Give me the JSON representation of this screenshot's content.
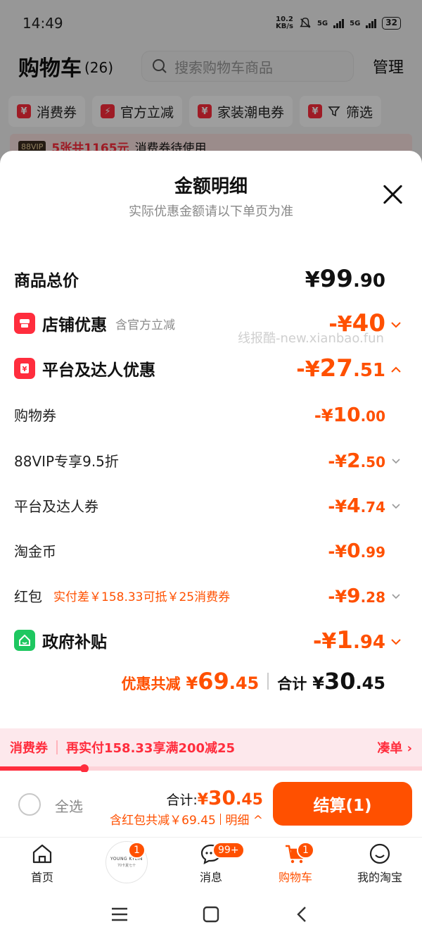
{
  "status": {
    "time": "14:49",
    "net_speed": "10.2",
    "net_unit": "KB/s",
    "sig1": "5G",
    "sig2": "5G",
    "battery": "32"
  },
  "header": {
    "title": "购物车",
    "count": "(26)",
    "search_placeholder": "搜索购物车商品",
    "manage": "管理"
  },
  "chips": [
    "消费券",
    "官方立减",
    "家装潮电券",
    "筛选"
  ],
  "vip_bar": {
    "tag": "88VIP",
    "amount": "5张共1165元",
    "text": "消费券待使用"
  },
  "sheet": {
    "title": "金额明细",
    "subtitle": "实际优惠金额请以下单页为准",
    "watermark": "线报酷-new.xianbao.fun",
    "total_price": {
      "label": "商品总价",
      "yen": "¥",
      "int": "99",
      "dec": ".90"
    },
    "shop_discount": {
      "label": "店铺优惠",
      "note": "含官方立减",
      "yen": "-¥",
      "int": "40",
      "dec": ""
    },
    "platform_discount": {
      "label": "平台及达人优惠",
      "yen": "-¥",
      "int": "27",
      "dec": ".51"
    },
    "items": [
      {
        "label": "购物券",
        "note": "",
        "yen": "-¥",
        "int": "10",
        "dec": ".00"
      },
      {
        "label": "88VIP专享9.5折",
        "note": "",
        "yen": "-¥",
        "int": "2",
        "dec": ".50"
      },
      {
        "label": "平台及达人券",
        "note": "",
        "yen": "-¥",
        "int": "4",
        "dec": ".74"
      },
      {
        "label": "淘金币",
        "note": "",
        "yen": "-¥",
        "int": "0",
        "dec": ".99"
      },
      {
        "label": "红包",
        "note": "实付差￥158.33可抵￥25消费券",
        "yen": "-¥",
        "int": "9",
        "dec": ".28"
      }
    ],
    "gov_subsidy": {
      "label": "政府补贴",
      "yen": "-¥",
      "int": "1",
      "dec": ".94"
    },
    "discount_total": {
      "label": "优惠共减",
      "yen": "¥",
      "int": "69",
      "dec": ".45"
    },
    "grand_total": {
      "label": "合计",
      "yen": "¥",
      "int": "30",
      "dec": ".45"
    }
  },
  "promo": {
    "tag": "消费券",
    "text": "再实付158.33享满200减25",
    "action": "凑单 ›",
    "progress": 0.2
  },
  "checkout": {
    "select_all": "全选",
    "sum_label": "合计:",
    "sum_yen": "¥",
    "sum_int": "30",
    "sum_dec": ".45",
    "sub_text": "含红包共减￥69.45",
    "detail": "明细 ^",
    "pay_button": "结算(1)"
  },
  "tabs": [
    {
      "label": "首页",
      "badge": ""
    },
    {
      "label": "YOUNG KYLIN",
      "sub": "70卡夏七十",
      "badge": "1"
    },
    {
      "label": "消息",
      "badge": "99+"
    },
    {
      "label": "购物车",
      "badge": "1"
    },
    {
      "label": "我的淘宝",
      "badge": ""
    }
  ],
  "colors": {
    "accent": "#ff5000",
    "red": "#ff2d3d",
    "green": "#1ec760"
  }
}
